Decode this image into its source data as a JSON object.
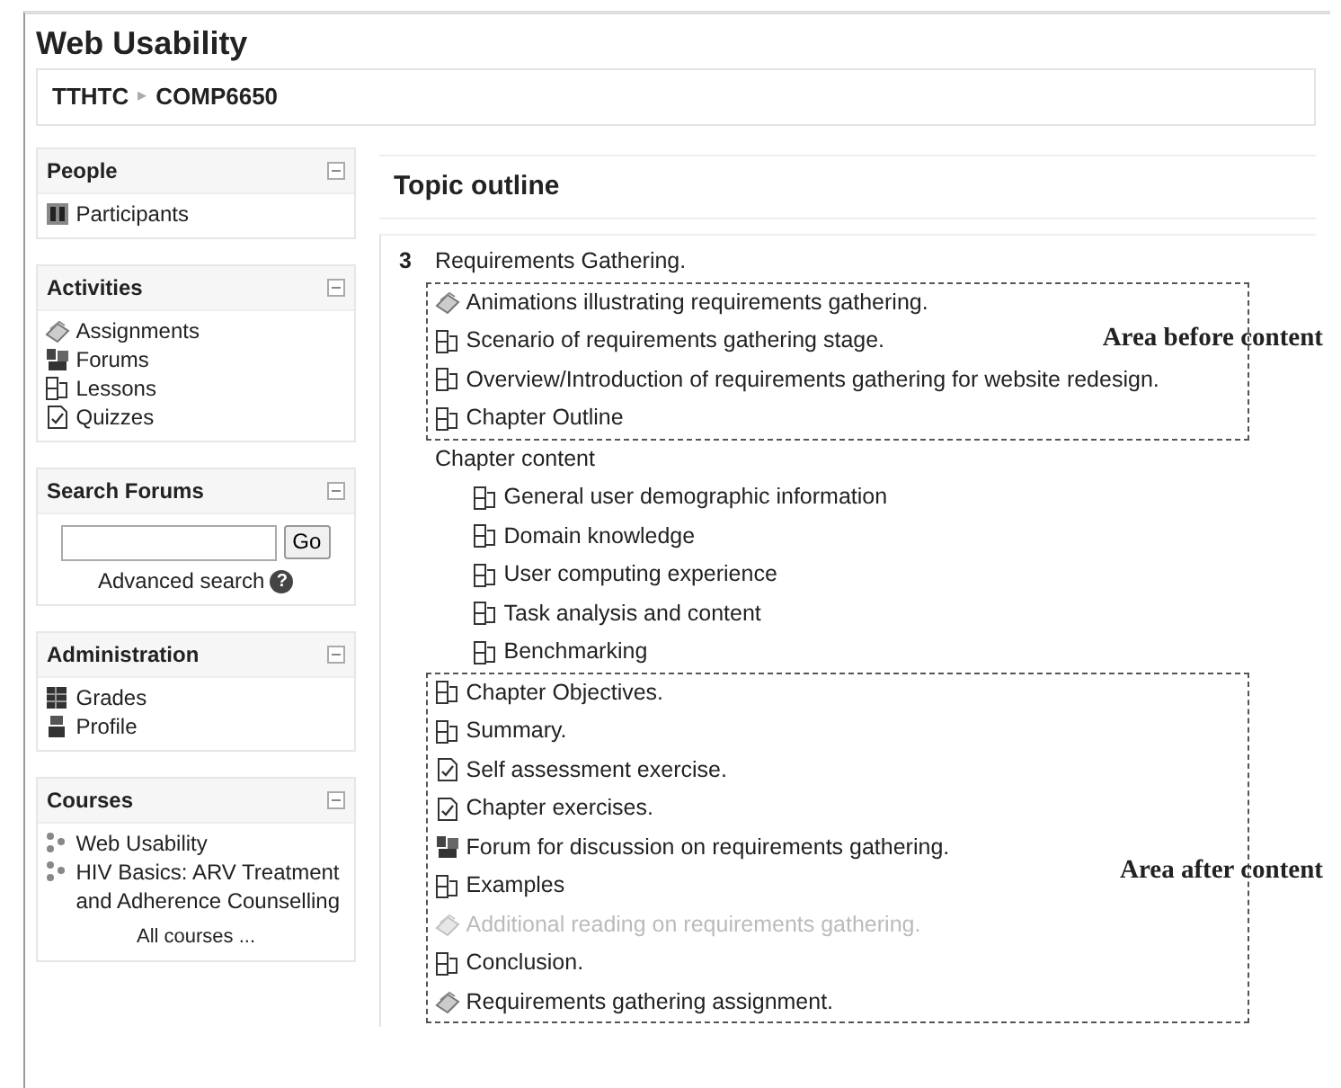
{
  "page_title": "Web Usability",
  "breadcrumb": {
    "items": [
      "TTHTC",
      "COMP6650"
    ],
    "separator": "▸"
  },
  "sidebar": [
    {
      "kind": "links",
      "title": "People",
      "links": [
        {
          "kind": "participants",
          "text": "Participants"
        }
      ]
    },
    {
      "kind": "links",
      "title": "Activities",
      "links": [
        {
          "kind": "assignment",
          "text": "Assignments"
        },
        {
          "kind": "forum",
          "text": "Forums"
        },
        {
          "kind": "resource",
          "text": "Lessons"
        },
        {
          "kind": "quiz",
          "text": "Quizzes"
        }
      ]
    },
    {
      "kind": "search",
      "title": "Search Forums",
      "button": "Go",
      "link": "Advanced search",
      "help": "?"
    },
    {
      "kind": "links",
      "title": "Administration",
      "links": [
        {
          "kind": "grades",
          "text": "Grades"
        },
        {
          "kind": "profile",
          "text": "Profile"
        }
      ]
    },
    {
      "kind": "links",
      "title": "Courses",
      "links": [
        {
          "kind": "course",
          "text": "Web Usability"
        },
        {
          "kind": "course",
          "text": "HIV Basics: ARV Treatment and Adherence Counselling"
        }
      ],
      "footer": "All courses ..."
    }
  ],
  "main": {
    "heading": "Topic outline",
    "section": {
      "number": "3",
      "title": "Requirements Gathering.",
      "before": {
        "label": "Area before content",
        "items": [
          {
            "kind": "assignment",
            "text": "Animations illustrating requirements gathering.",
            "dimmed": false
          },
          {
            "kind": "resource",
            "text": "Scenario of requirements gathering stage.",
            "dimmed": false
          },
          {
            "kind": "resource",
            "text": "Overview/Introduction of requirements gathering for website redesign.",
            "dimmed": false
          },
          {
            "kind": "resource",
            "text": "Chapter Outline",
            "dimmed": false
          }
        ]
      },
      "content": {
        "heading": "Chapter content",
        "items": [
          {
            "kind": "resource",
            "text": "General user demographic information",
            "dimmed": false
          },
          {
            "kind": "resource",
            "text": "Domain knowledge",
            "dimmed": false
          },
          {
            "kind": "resource",
            "text": "User computing experience",
            "dimmed": false
          },
          {
            "kind": "resource",
            "text": "Task analysis and content",
            "dimmed": false
          },
          {
            "kind": "resource",
            "text": "Benchmarking",
            "dimmed": false
          }
        ]
      },
      "after": {
        "label": "Area after content",
        "items": [
          {
            "kind": "resource",
            "text": "Chapter Objectives.",
            "dimmed": false
          },
          {
            "kind": "resource",
            "text": "Summary.",
            "dimmed": false
          },
          {
            "kind": "quiz",
            "text": "Self assessment exercise.",
            "dimmed": false
          },
          {
            "kind": "quiz",
            "text": "Chapter exercises.",
            "dimmed": false
          },
          {
            "kind": "forum",
            "text": "Forum for discussion on requirements gathering.",
            "dimmed": false
          },
          {
            "kind": "resource",
            "text": "Examples",
            "dimmed": false
          },
          {
            "kind": "assignment",
            "text": "Additional reading on requirements gathering.",
            "dimmed": true
          },
          {
            "kind": "resource",
            "text": "Conclusion.",
            "dimmed": false
          },
          {
            "kind": "assignment",
            "text": "Requirements gathering assignment.",
            "dimmed": false
          }
        ]
      }
    }
  }
}
